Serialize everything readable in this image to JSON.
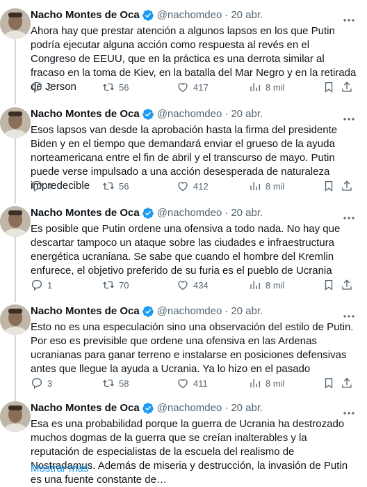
{
  "colors": {
    "accent": "#1d9bf0",
    "text": "#0f1419",
    "secondary": "#536471",
    "verified": "#1d9bf0"
  },
  "tweets": [
    {
      "name": "Nacho Montes de Oca",
      "handle": "@nachomdeo",
      "dot": "·",
      "time": "20 abr.",
      "text": "Ahora hay que prestar atención a algunos lapsos en los que Putin podría ejecutar alguna acción como respuesta al revés en el Congreso de EEUU, que en la práctica es una derrota similar al fracaso en la toma de Kiev, en la batalla del Mar Negro y en la retirada de Jerson",
      "replies": "2",
      "retweets": "56",
      "likes": "417",
      "views": "8 mil"
    },
    {
      "name": "Nacho Montes de Oca",
      "handle": "@nachomdeo",
      "dot": "·",
      "time": "20 abr.",
      "text": "Esos lapsos van desde la aprobación hasta la firma del presidente Biden y en el tiempo que demandará enviar el grueso de la ayuda norteamericana entre el fin de abril y el transcurso de mayo. Putin puede verse impulsado a una acción desesperada de naturaleza impredecible",
      "replies": "4",
      "retweets": "56",
      "likes": "412",
      "views": "8 mil"
    },
    {
      "name": "Nacho Montes de Oca",
      "handle": "@nachomdeo",
      "dot": "·",
      "time": "20 abr.",
      "text": "Es posible que Putin ordene una ofensiva a todo nada. No hay que descartar tampoco un ataque sobre las ciudades e infraestructura energética ucraniana. Se sabe que cuando el hombre del Kremlin enfurece, el objetivo preferido de su furia es el pueblo de Ucrania",
      "replies": "1",
      "retweets": "70",
      "likes": "434",
      "views": "8 mil"
    },
    {
      "name": "Nacho Montes de Oca",
      "handle": "@nachomdeo",
      "dot": "·",
      "time": "20 abr.",
      "text": "Esto no es una especulación sino una observación del estilo de Putin. Por eso es previsible que ordene una ofensiva en las Ardenas ucranianas para ganar terreno e instalarse en posiciones defensivas antes que llegue la ayuda a Ucrania. Ya lo hizo en el pasado",
      "replies": "3",
      "retweets": "58",
      "likes": "411",
      "views": "8 mil"
    },
    {
      "name": "Nacho Montes de Oca",
      "handle": "@nachomdeo",
      "dot": "·",
      "time": "20 abr.",
      "text": "Esa es una probabilidad porque la guerra de Ucrania ha destrozado muchos dogmas de la guerra que se creían inalterables y la reputación de especialistas de la escuela del realismo de Nostradamus. Además de miseria y destrucción, la invasión de Putin es una fuente constante de…"
    }
  ],
  "show_more": "Mostrar más"
}
